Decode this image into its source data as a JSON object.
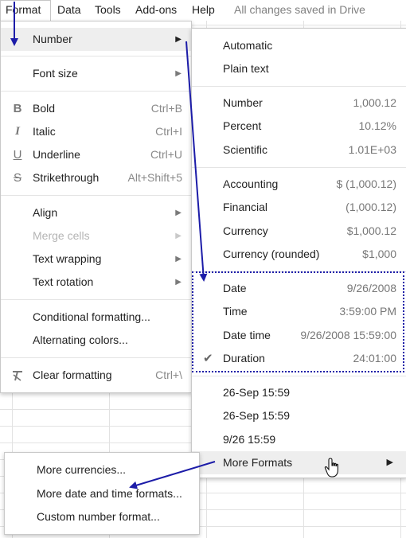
{
  "menubar": {
    "items": [
      "Format",
      "Data",
      "Tools",
      "Add-ons",
      "Help"
    ],
    "status": "All changes saved in Drive"
  },
  "format_menu": {
    "number": "Number",
    "font_size": "Font size",
    "bold": {
      "label": "Bold",
      "shortcut": "Ctrl+B",
      "icon": "bold-icon"
    },
    "italic": {
      "label": "Italic",
      "shortcut": "Ctrl+I",
      "icon": "italic-icon"
    },
    "underline": {
      "label": "Underline",
      "shortcut": "Ctrl+U",
      "icon": "underline-icon"
    },
    "strikethrough": {
      "label": "Strikethrough",
      "shortcut": "Alt+Shift+5",
      "icon": "strikethrough-icon"
    },
    "align": "Align",
    "merge_cells": "Merge cells",
    "text_wrapping": "Text wrapping",
    "text_rotation": "Text rotation",
    "conditional_formatting": "Conditional formatting...",
    "alternating_colors": "Alternating colors...",
    "clear_formatting": {
      "label": "Clear formatting",
      "shortcut": "Ctrl+\\",
      "icon": "clear-formatting-icon"
    }
  },
  "number_menu": {
    "automatic": "Automatic",
    "plain_text": "Plain text",
    "number": {
      "label": "Number",
      "example": "1,000.12"
    },
    "percent": {
      "label": "Percent",
      "example": "10.12%"
    },
    "scientific": {
      "label": "Scientific",
      "example": "1.01E+03"
    },
    "accounting": {
      "label": "Accounting",
      "example": "$ (1,000.12)"
    },
    "financial": {
      "label": "Financial",
      "example": "(1,000.12)"
    },
    "currency": {
      "label": "Currency",
      "example": "$1,000.12"
    },
    "currency_rounded": {
      "label": "Currency (rounded)",
      "example": "$1,000"
    },
    "date": {
      "label": "Date",
      "example": "9/26/2008"
    },
    "time": {
      "label": "Time",
      "example": "3:59:00 PM"
    },
    "date_time": {
      "label": "Date time",
      "example": "9/26/2008 15:59:00"
    },
    "duration": {
      "label": "Duration",
      "example": "24:01:00"
    },
    "custom1": "26-Sep 15:59",
    "custom2": "26-Sep 15:59",
    "custom3": "9/26 15:59",
    "more_formats": "More Formats"
  },
  "more_formats_menu": {
    "more_currencies": "More currencies...",
    "more_date_time": "More date and time formats...",
    "custom_number": "Custom number format..."
  },
  "colors": {
    "highlight": "#eeeeee",
    "annotation": "#1c1ca8"
  }
}
